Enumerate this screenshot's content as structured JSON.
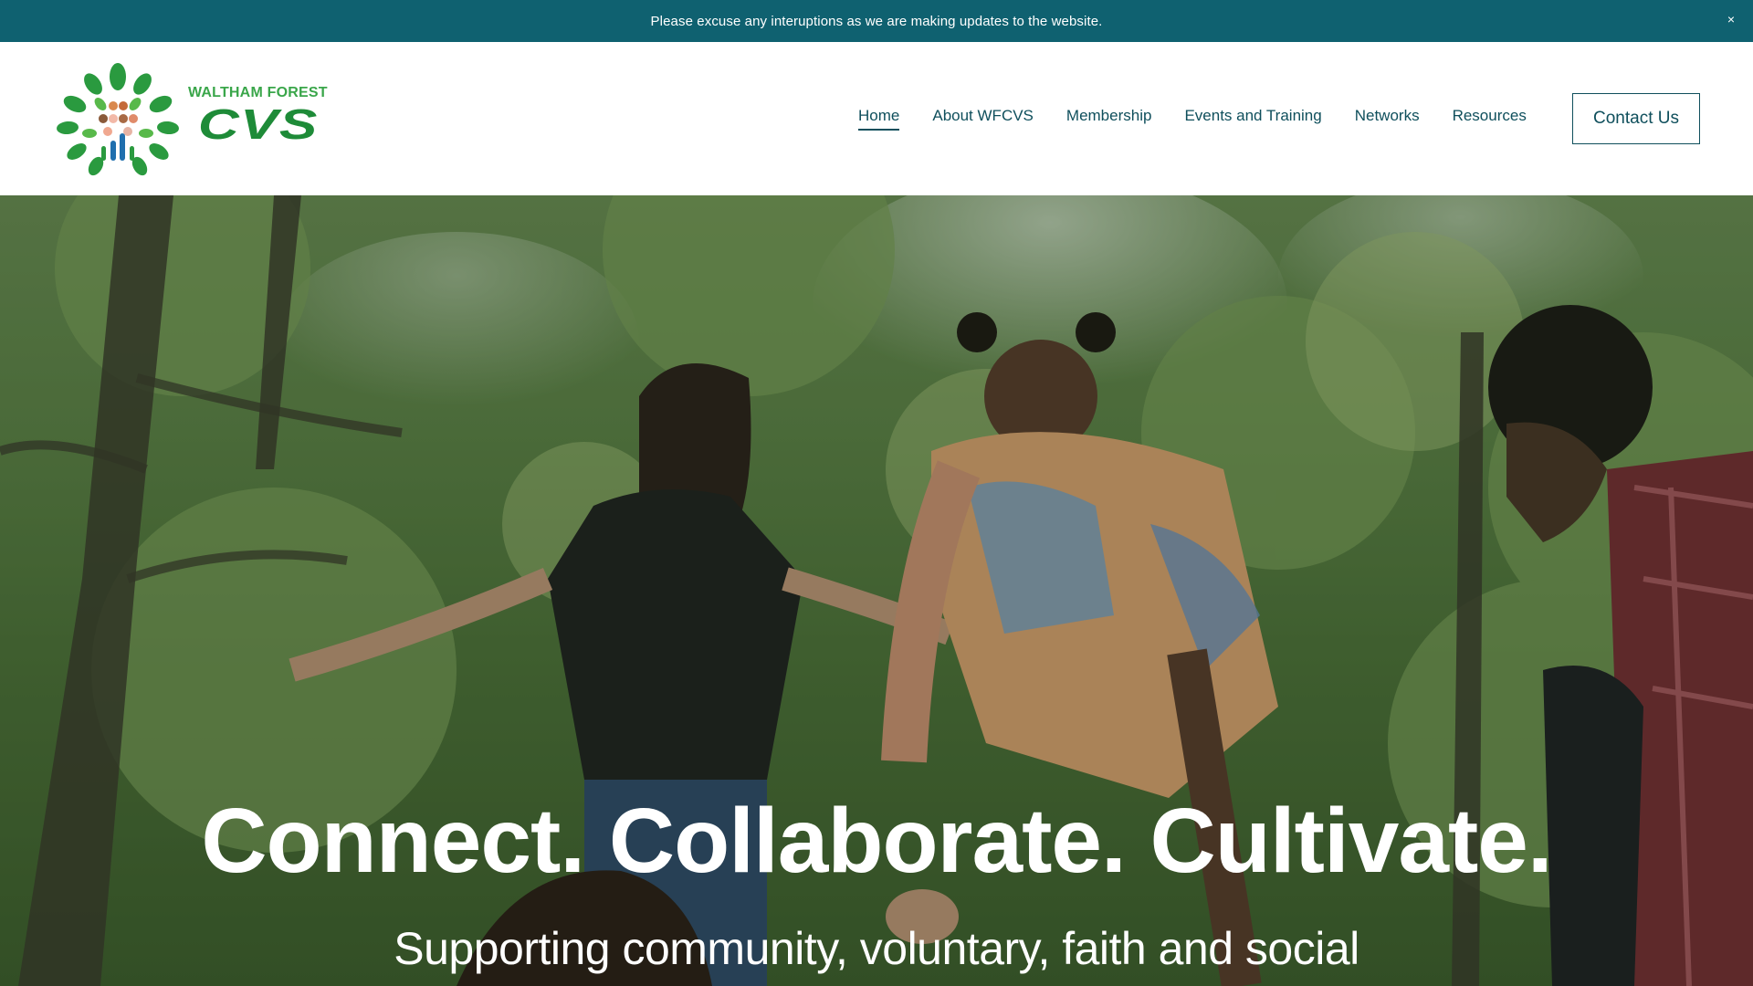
{
  "announcement": {
    "text": "Please excuse any interuptions as we are making updates to the website.",
    "close_label": "×"
  },
  "logo": {
    "line1": "WALTHAM FOREST",
    "line2": "CVS",
    "colors": {
      "green": "#1e8b38",
      "light_green": "#3aa64a",
      "blue": "#1f6fae"
    }
  },
  "nav": {
    "items": [
      {
        "label": "Home",
        "active": true
      },
      {
        "label": "About WFCVS",
        "active": false
      },
      {
        "label": "Membership",
        "active": false
      },
      {
        "label": "Events and Training",
        "active": false
      },
      {
        "label": "Networks",
        "active": false
      },
      {
        "label": "Resources",
        "active": false
      }
    ],
    "contact_label": "Contact Us"
  },
  "hero": {
    "title": "Connect. Collaborate. Cultivate.",
    "subtitle": "Supporting community, voluntary, faith and social"
  },
  "colors": {
    "announcement_bg": "#0f6170",
    "nav_text": "#0f4f5c"
  }
}
